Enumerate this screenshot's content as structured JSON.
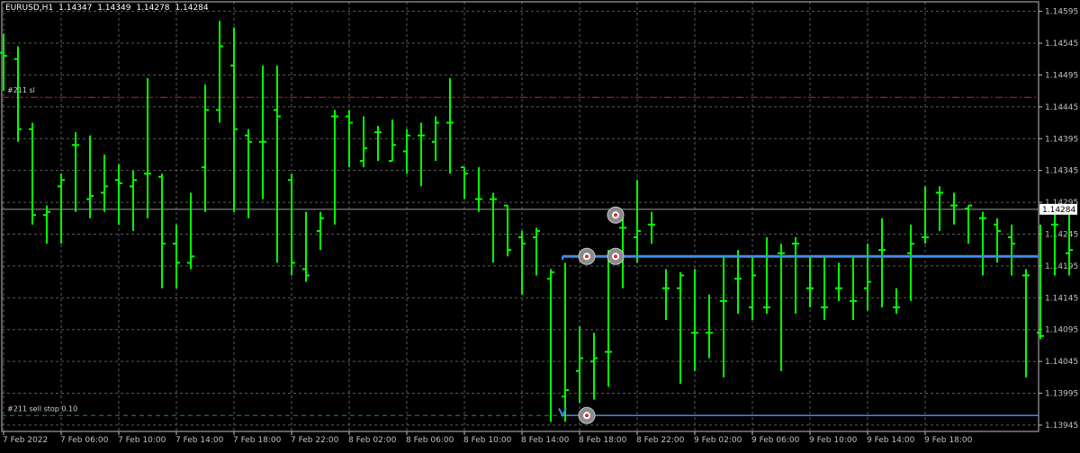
{
  "header": {
    "symbol": "EURUSD,H1",
    "open": "1.14347",
    "high": "1.14349",
    "low": "1.14278",
    "close": "1.14284"
  },
  "colors": {
    "background": "#000000",
    "grid": "#5a5a5a",
    "axis": "#c0c0c0",
    "candle": "#00ff00",
    "sl_line": "#cc2222",
    "order_line": "#3a8ee6",
    "stop_line": "#00aa00",
    "price_label_bg": "#ffffff",
    "price_label_fg": "#000000"
  },
  "chart_data": {
    "type": "ohlc",
    "symbol": "EURUSD",
    "timeframe": "H1",
    "y_axis": {
      "ticks": [
        "1.14595",
        "1.14545",
        "1.14495",
        "1.14445",
        "1.14395",
        "1.14345",
        "1.14295",
        "1.14245",
        "1.14195",
        "1.14145",
        "1.14095",
        "1.14045",
        "1.13995",
        "1.13945"
      ],
      "range": [
        1.13935,
        1.1461
      ],
      "side": "right"
    },
    "x_axis": {
      "ticks": [
        "7 Feb 2022",
        "7 Feb 06:00",
        "7 Feb 10:00",
        "7 Feb 14:00",
        "7 Feb 18:00",
        "7 Feb 22:00",
        "8 Feb 02:00",
        "8 Feb 06:00",
        "8 Feb 10:00",
        "8 Feb 14:00",
        "8 Feb 18:00",
        "8 Feb 22:00",
        "9 Feb 02:00",
        "9 Feb 06:00",
        "9 Feb 10:00",
        "9 Feb 14:00",
        "9 Feb 18:00"
      ],
      "hours_per_tick": 4
    },
    "current_price": "1.14284",
    "bars": [
      {
        "o": 1.1453,
        "h": 1.1456,
        "l": 1.1447,
        "c": 1.14525
      },
      {
        "o": 1.1452,
        "h": 1.1454,
        "l": 1.1439,
        "c": 1.1441
      },
      {
        "o": 1.1441,
        "h": 1.1442,
        "l": 1.1426,
        "c": 1.14275
      },
      {
        "o": 1.14275,
        "h": 1.1429,
        "l": 1.1423,
        "c": 1.1428
      },
      {
        "o": 1.1432,
        "h": 1.1434,
        "l": 1.1423,
        "c": 1.1433
      },
      {
        "o": 1.14385,
        "h": 1.14405,
        "l": 1.1428,
        "c": 1.14385
      },
      {
        "o": 1.143,
        "h": 1.144,
        "l": 1.1427,
        "c": 1.14305
      },
      {
        "o": 1.1431,
        "h": 1.1437,
        "l": 1.1428,
        "c": 1.1432
      },
      {
        "o": 1.1433,
        "h": 1.14355,
        "l": 1.1426,
        "c": 1.14325
      },
      {
        "o": 1.1432,
        "h": 1.14345,
        "l": 1.1425,
        "c": 1.1433
      },
      {
        "o": 1.1434,
        "h": 1.1449,
        "l": 1.1427,
        "c": 1.1434
      },
      {
        "o": 1.14335,
        "h": 1.1434,
        "l": 1.1416,
        "c": 1.1423
      },
      {
        "o": 1.1423,
        "h": 1.1426,
        "l": 1.1416,
        "c": 1.142
      },
      {
        "o": 1.142,
        "h": 1.1431,
        "l": 1.1419,
        "c": 1.1421
      },
      {
        "o": 1.1435,
        "h": 1.1448,
        "l": 1.1428,
        "c": 1.1444
      },
      {
        "o": 1.1444,
        "h": 1.1458,
        "l": 1.1442,
        "c": 1.1454
      },
      {
        "o": 1.1451,
        "h": 1.1457,
        "l": 1.1428,
        "c": 1.1441
      },
      {
        "o": 1.144,
        "h": 1.1441,
        "l": 1.1427,
        "c": 1.1439
      },
      {
        "o": 1.1439,
        "h": 1.1451,
        "l": 1.143,
        "c": 1.1439
      },
      {
        "o": 1.1444,
        "h": 1.1451,
        "l": 1.142,
        "c": 1.1443
      },
      {
        "o": 1.1433,
        "h": 1.1434,
        "l": 1.1418,
        "c": 1.142
      },
      {
        "o": 1.1419,
        "h": 1.1428,
        "l": 1.1417,
        "c": 1.1418
      },
      {
        "o": 1.1425,
        "h": 1.1428,
        "l": 1.1422,
        "c": 1.1427
      },
      {
        "o": 1.1443,
        "h": 1.1444,
        "l": 1.1426,
        "c": 1.1443
      },
      {
        "o": 1.1443,
        "h": 1.1444,
        "l": 1.1435,
        "c": 1.1442
      },
      {
        "o": 1.1436,
        "h": 1.1443,
        "l": 1.1435,
        "c": 1.1438
      },
      {
        "o": 1.14405,
        "h": 1.14415,
        "l": 1.1436,
        "c": 1.14405
      },
      {
        "o": 1.1436,
        "h": 1.14425,
        "l": 1.1436,
        "c": 1.14385
      },
      {
        "o": 1.14375,
        "h": 1.1441,
        "l": 1.1434,
        "c": 1.144
      },
      {
        "o": 1.144,
        "h": 1.1442,
        "l": 1.1432,
        "c": 1.144
      },
      {
        "o": 1.1439,
        "h": 1.1443,
        "l": 1.1436,
        "c": 1.1442
      },
      {
        "o": 1.1442,
        "h": 1.1449,
        "l": 1.1434,
        "c": 1.1442
      },
      {
        "o": 1.1435,
        "h": 1.1435,
        "l": 1.143,
        "c": 1.1434
      },
      {
        "o": 1.143,
        "h": 1.1435,
        "l": 1.1428,
        "c": 1.143
      },
      {
        "o": 1.143,
        "h": 1.1431,
        "l": 1.142,
        "c": 1.143
      },
      {
        "o": 1.1429,
        "h": 1.1429,
        "l": 1.1421,
        "c": 1.1422
      },
      {
        "o": 1.1424,
        "h": 1.1425,
        "l": 1.1415,
        "c": 1.1423
      },
      {
        "o": 1.1424,
        "h": 1.14255,
        "l": 1.1418,
        "c": 1.1425
      },
      {
        "o": 1.14175,
        "h": 1.1419,
        "l": 1.1395,
        "c": 1.14185
      },
      {
        "o": 1.1399,
        "h": 1.142,
        "l": 1.1395,
        "c": 1.14
      },
      {
        "o": 1.1403,
        "h": 1.141,
        "l": 1.1398,
        "c": 1.1405
      },
      {
        "o": 1.14045,
        "h": 1.1409,
        "l": 1.13985,
        "c": 1.1405
      },
      {
        "o": 1.1406,
        "h": 1.1422,
        "l": 1.14005,
        "c": 1.1406
      },
      {
        "o": 1.14255,
        "h": 1.1427,
        "l": 1.1416,
        "c": 1.14255
      },
      {
        "o": 1.1424,
        "h": 1.1433,
        "l": 1.142,
        "c": 1.1425
      },
      {
        "o": 1.1426,
        "h": 1.1428,
        "l": 1.1423,
        "c": 1.1426
      },
      {
        "o": 1.1416,
        "h": 1.1419,
        "l": 1.1411,
        "c": 1.1416
      },
      {
        "o": 1.1416,
        "h": 1.14185,
        "l": 1.1401,
        "c": 1.1418
      },
      {
        "o": 1.1409,
        "h": 1.1419,
        "l": 1.1403,
        "c": 1.1409
      },
      {
        "o": 1.1409,
        "h": 1.1415,
        "l": 1.1405,
        "c": 1.1409
      },
      {
        "o": 1.1414,
        "h": 1.1421,
        "l": 1.1402,
        "c": 1.1414
      },
      {
        "o": 1.14175,
        "h": 1.1422,
        "l": 1.1412,
        "c": 1.14175
      },
      {
        "o": 1.1413,
        "h": 1.1421,
        "l": 1.1411,
        "c": 1.1418
      },
      {
        "o": 1.1413,
        "h": 1.1424,
        "l": 1.1412,
        "c": 1.1413
      },
      {
        "o": 1.14215,
        "h": 1.1423,
        "l": 1.1403,
        "c": 1.14215
      },
      {
        "o": 1.1423,
        "h": 1.1424,
        "l": 1.1412,
        "c": 1.1423
      },
      {
        "o": 1.1416,
        "h": 1.1421,
        "l": 1.1413,
        "c": 1.1416
      },
      {
        "o": 1.1413,
        "h": 1.1421,
        "l": 1.1411,
        "c": 1.1413
      },
      {
        "o": 1.1416,
        "h": 1.142,
        "l": 1.1414,
        "c": 1.1416
      },
      {
        "o": 1.1414,
        "h": 1.1421,
        "l": 1.1411,
        "c": 1.1414
      },
      {
        "o": 1.1416,
        "h": 1.1423,
        "l": 1.14125,
        "c": 1.1417
      },
      {
        "o": 1.1422,
        "h": 1.1427,
        "l": 1.1413,
        "c": 1.1422
      },
      {
        "o": 1.1413,
        "h": 1.1416,
        "l": 1.1412,
        "c": 1.1413
      },
      {
        "o": 1.14215,
        "h": 1.1426,
        "l": 1.1414,
        "c": 1.1423
      },
      {
        "o": 1.1424,
        "h": 1.1432,
        "l": 1.1423,
        "c": 1.1424
      },
      {
        "o": 1.1431,
        "h": 1.1432,
        "l": 1.1425,
        "c": 1.1431
      },
      {
        "o": 1.1429,
        "h": 1.1431,
        "l": 1.1426,
        "c": 1.1429
      },
      {
        "o": 1.14285,
        "h": 1.1429,
        "l": 1.1423,
        "c": 1.1429
      },
      {
        "o": 1.1427,
        "h": 1.1428,
        "l": 1.1418,
        "c": 1.1427
      },
      {
        "o": 1.1426,
        "h": 1.1427,
        "l": 1.142,
        "c": 1.1425
      },
      {
        "o": 1.1424,
        "h": 1.1426,
        "l": 1.1418,
        "c": 1.1423
      },
      {
        "o": 1.1418,
        "h": 1.1419,
        "l": 1.1402,
        "c": 1.1418
      },
      {
        "o": 1.1409,
        "h": 1.1426,
        "l": 1.1408,
        "c": 1.14085
      },
      {
        "o": 1.1426,
        "h": 1.1428,
        "l": 1.1418,
        "c": 1.1426
      },
      {
        "o": 1.14215,
        "h": 1.1428,
        "l": 1.1418,
        "c": 1.1422
      },
      {
        "o": 1.1424,
        "h": 1.1428,
        "l": 1.1423,
        "c": 1.14245
      },
      {
        "o": 1.1426,
        "h": 1.1445,
        "l": 1.1425,
        "c": 1.1441
      },
      {
        "o": 1.14405,
        "h": 1.1443,
        "l": 1.143,
        "c": 1.1441
      },
      {
        "o": 1.143,
        "h": 1.1434,
        "l": 1.1429,
        "c": 1.14295
      },
      {
        "o": 1.1437,
        "h": 1.1441,
        "l": 1.143,
        "c": 1.1437
      },
      {
        "o": 1.1435,
        "h": 1.1446,
        "l": 1.1431,
        "c": 1.1435
      },
      {
        "o": 1.1433,
        "h": 1.1437,
        "l": 1.1425,
        "c": 1.1432
      },
      {
        "o": 1.1432,
        "h": 1.1435,
        "l": 1.1427,
        "c": 1.1427
      },
      {
        "o": 1.1428,
        "h": 1.14415,
        "l": 1.1427,
        "c": 1.14325
      },
      {
        "o": 1.14275,
        "h": 1.1441,
        "l": 1.1426,
        "c": 1.1428
      },
      {
        "o": 1.1434,
        "h": 1.14345,
        "l": 1.14275,
        "c": 1.14284
      }
    ]
  },
  "trade_lines": {
    "sl_label": "#211 sl",
    "sl_price": 1.1446,
    "order_price": 1.1421,
    "order_start_bar": 39,
    "stop_label": "#211 sell stop 0.10",
    "stop_price": 1.13955,
    "stop_line_price": 1.1396
  },
  "markers": [
    {
      "name": "trade-open-marker",
      "bar": 40,
      "price": 1.1421
    },
    {
      "name": "trade-modify-marker",
      "bar": 42,
      "price": 1.1421
    },
    {
      "name": "trade-close-marker",
      "bar": 42,
      "price": 1.14275
    },
    {
      "name": "stop-order-marker",
      "bar": 40,
      "price": 1.1396
    }
  ]
}
